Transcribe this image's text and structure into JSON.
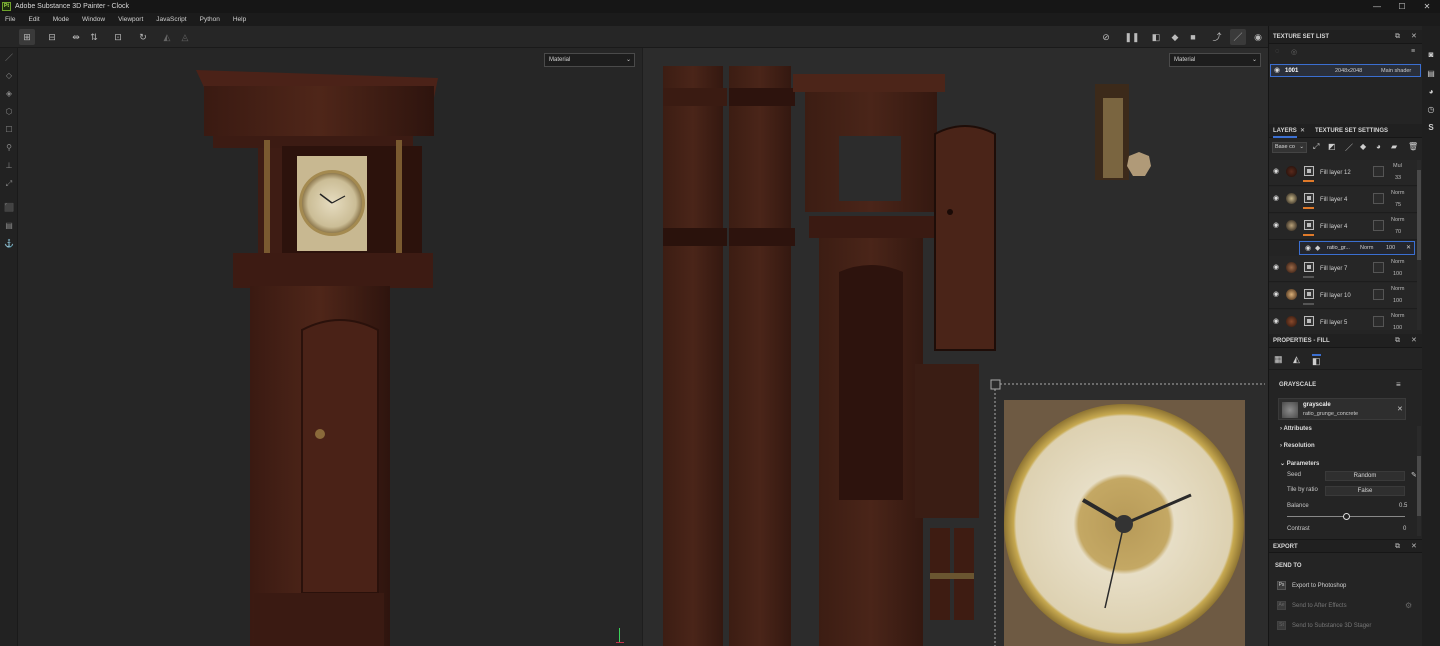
{
  "window": {
    "title": "Adobe Substance 3D Painter - Clock",
    "logo_text": "Pt",
    "minimize": "—",
    "maximize": "☐",
    "close": "✕"
  },
  "menu": [
    "File",
    "Edit",
    "Mode",
    "Window",
    "Viewport",
    "JavaScript",
    "Python",
    "Help"
  ],
  "viewport3d": {
    "channel_dropdown": "Material"
  },
  "viewport2d": {
    "channel_dropdown": "Material"
  },
  "texture_set_list": {
    "header": "TEXTURE SET LIST",
    "items": [
      {
        "name": "1001",
        "resolution": "2048x2048",
        "shader": "Main shader"
      }
    ]
  },
  "layers_panel": {
    "tabs": [
      "LAYERS",
      "TEXTURE SET SETTINGS"
    ],
    "channel_select": "Base co",
    "layers": [
      {
        "name": "Fill layer 12",
        "blend": "Mul",
        "opacity": "33"
      },
      {
        "name": "Fill layer 4",
        "blend": "Norm",
        "opacity": "75"
      },
      {
        "name": "Fill layer 4",
        "blend": "Norm",
        "opacity": "70"
      },
      {
        "name": "Fill layer 7",
        "blend": "Norm",
        "opacity": "100"
      },
      {
        "name": "Fill layer 10",
        "blend": "Norm",
        "opacity": "100"
      },
      {
        "name": "Fill layer 5",
        "blend": "Norm",
        "opacity": "100"
      }
    ],
    "sub_effect": {
      "name": "ratio_gr...",
      "blend": "Norm",
      "opacity": "100"
    }
  },
  "properties": {
    "header": "PROPERTIES - FILL",
    "section": "GRAYSCALE",
    "resource_name": "grayscale",
    "resource_file": "ratio_grunge_concrete",
    "groups": [
      "Attributes",
      "Resolution",
      "Parameters"
    ],
    "params": {
      "seed_label": "Seed",
      "seed_value": "Random",
      "tile_label": "Tile by ratio",
      "tile_value": "False",
      "balance_label": "Balance",
      "balance_value": "0.5",
      "contrast_label": "Contrast",
      "contrast_value": "0"
    }
  },
  "export": {
    "header": "EXPORT",
    "send_to": "SEND TO",
    "items": [
      {
        "label": "Export to Photoshop",
        "icon": "Ps",
        "enabled": true
      },
      {
        "label": "Send to After Effects",
        "icon": "Ae",
        "enabled": false
      },
      {
        "label": "Send to Substance 3D Stager",
        "icon": "St",
        "enabled": false
      }
    ]
  },
  "colors": {
    "accent": "#3b6fd1",
    "orange": "#e07a2a",
    "wood": "#4a2318"
  },
  "icons": [
    "grid-icon",
    "symmetry-icon",
    "reset-icon",
    "pause-icon",
    "camera-icon",
    "eye-icon",
    "brush-icon",
    "eraser-icon",
    "fill-icon",
    "folder-icon",
    "trash-icon"
  ]
}
